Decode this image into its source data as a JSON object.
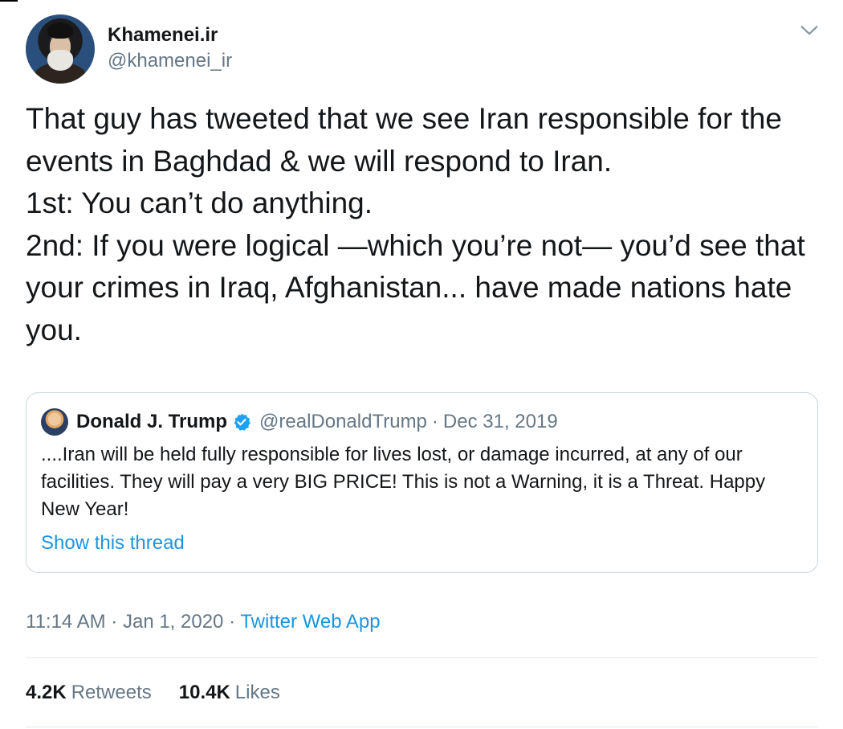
{
  "author": {
    "display_name": "Khamenei.ir",
    "handle": "@khamenei_ir"
  },
  "tweet": {
    "text": "That guy has tweeted that we see Iran responsible for the events in Baghdad & we will respond to Iran.\n1st: You can’t do anything.\n2nd: If you were logical —which you’re not— you’d see that your crimes in Iraq, Afghanistan... have made nations hate you.",
    "time": "11:14 AM",
    "date": "Jan 1, 2020",
    "source": "Twitter Web App",
    "separator": "·"
  },
  "quoted": {
    "display_name": "Donald J. Trump",
    "handle": "@realDonaldTrump",
    "separator": "·",
    "date": "Dec 31, 2019",
    "text": "....Iran will be held fully responsible for lives lost, or damage incurred, at any of our facilities. They will pay a very BIG PRICE! This is not a Warning, it is a Threat. Happy New Year!",
    "show_thread": "Show this thread"
  },
  "stats": {
    "retweets_count": "4.2K",
    "retweets_label": "Retweets",
    "likes_count": "10.4K",
    "likes_label": "Likes"
  },
  "colors": {
    "text": "#14171a",
    "secondary": "#657786",
    "link": "#1b95e0",
    "border": "#ccd6dd",
    "verified": "#1da1f2"
  },
  "icons": {
    "menu": "chevron-down-icon",
    "verified": "verified-badge-icon"
  }
}
